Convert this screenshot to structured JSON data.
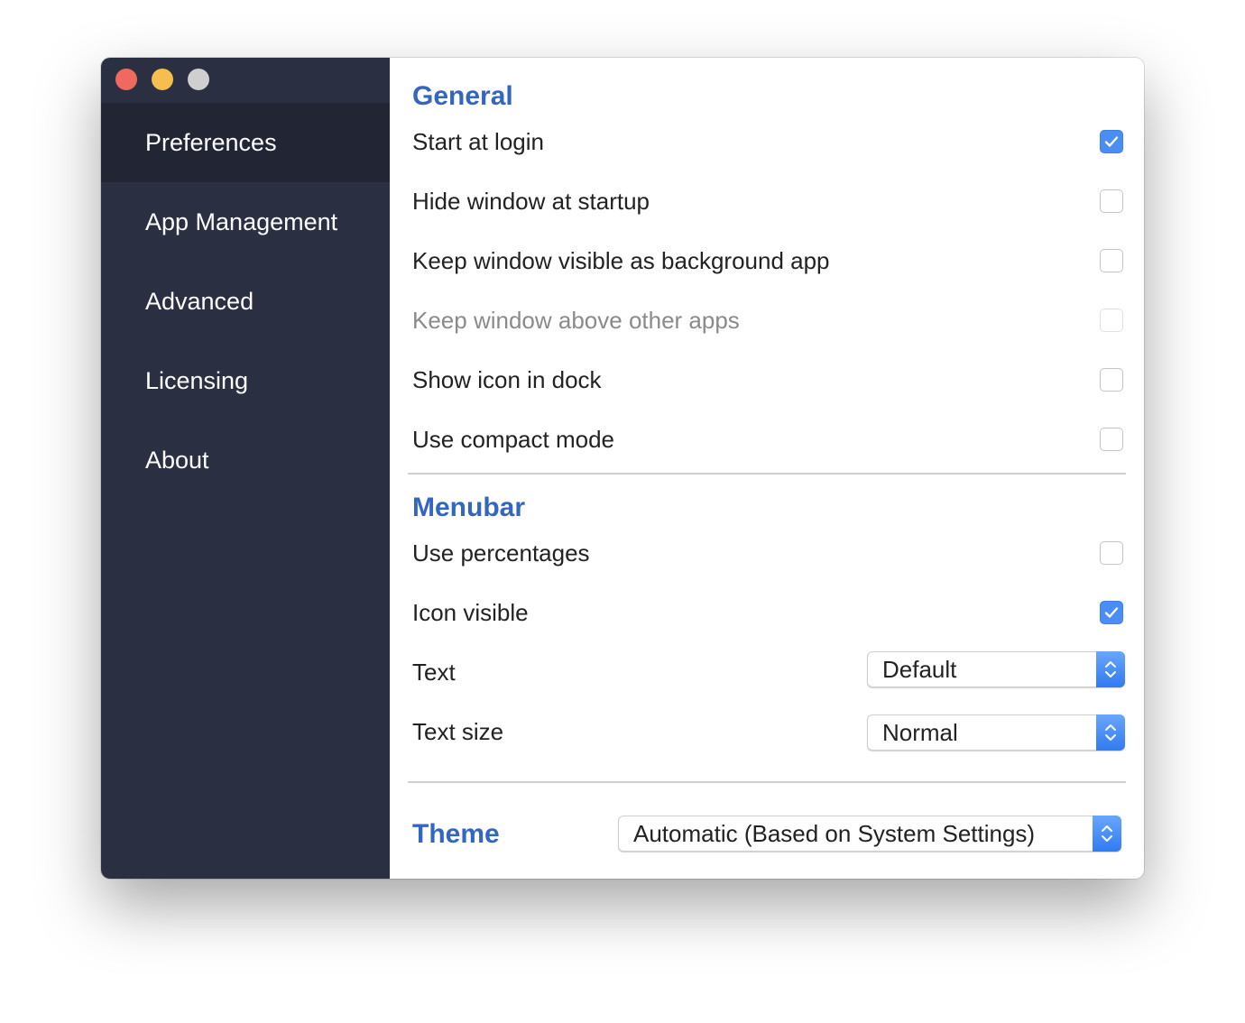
{
  "sidebar": {
    "items": [
      {
        "label": "Preferences",
        "active": true
      },
      {
        "label": "App Management",
        "active": false
      },
      {
        "label": "Advanced",
        "active": false
      },
      {
        "label": "Licensing",
        "active": false
      },
      {
        "label": "About",
        "active": false
      }
    ]
  },
  "general": {
    "title": "General",
    "options": [
      {
        "label": "Start at login",
        "checked": true,
        "disabled": false
      },
      {
        "label": "Hide window at startup",
        "checked": false,
        "disabled": false
      },
      {
        "label": "Keep window visible as background app",
        "checked": false,
        "disabled": false
      },
      {
        "label": "Keep window above other apps",
        "checked": false,
        "disabled": true
      },
      {
        "label": "Show icon in dock",
        "checked": false,
        "disabled": false
      },
      {
        "label": "Use compact mode",
        "checked": false,
        "disabled": false
      }
    ]
  },
  "menubar": {
    "title": "Menubar",
    "options": [
      {
        "label": "Use percentages",
        "checked": false
      },
      {
        "label": "Icon visible",
        "checked": true
      }
    ],
    "text": {
      "label": "Text",
      "value": "Default"
    },
    "text_size": {
      "label": "Text size",
      "value": "Normal"
    }
  },
  "theme": {
    "title": "Theme",
    "value": "Automatic (Based on System Settings)"
  },
  "colors": {
    "accent": "#3366c0",
    "checkbox_checked": "#4a8ef5",
    "sidebar_bg": "#2a2f42",
    "sidebar_active": "#222634"
  }
}
